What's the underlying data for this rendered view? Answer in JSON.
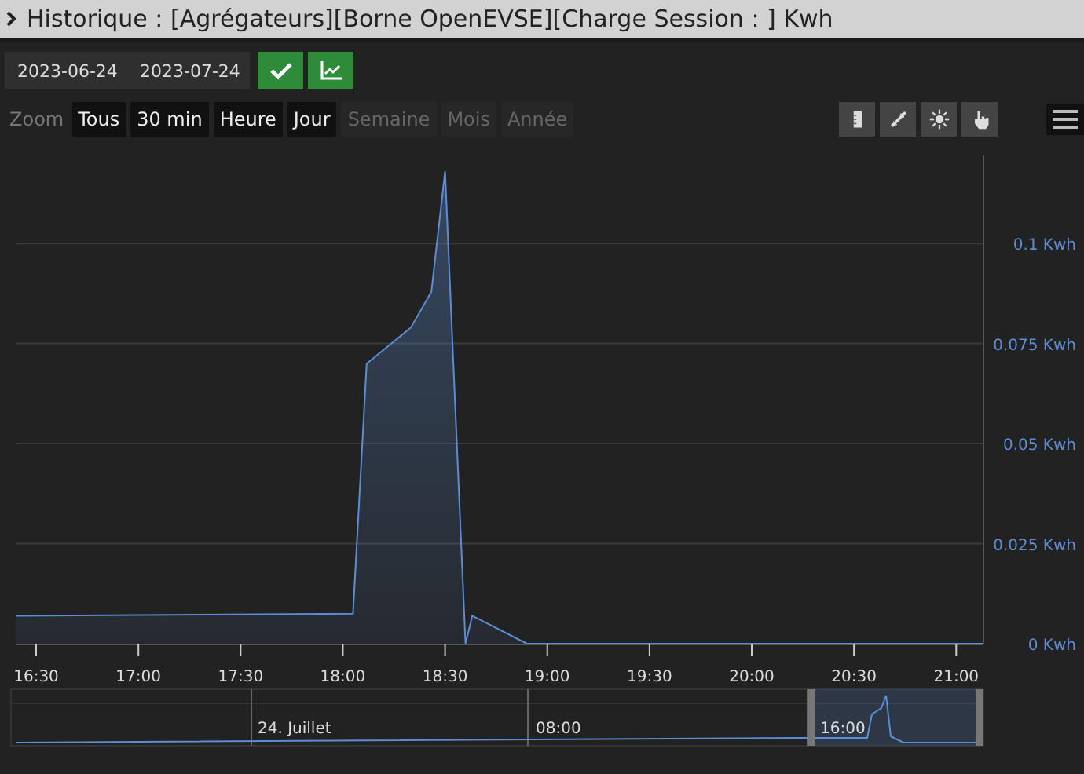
{
  "header": {
    "title": "Historique : [Agrégateurs][Borne OpenEVSE][Charge Session : ] Kwh"
  },
  "date_range": {
    "start": "2023-06-24",
    "end": "2023-07-24"
  },
  "zoom": {
    "label": "Zoom",
    "buttons": [
      {
        "label": "Tous",
        "disabled": false
      },
      {
        "label": "30 min",
        "disabled": false
      },
      {
        "label": "Heure",
        "disabled": false
      },
      {
        "label": "Jour",
        "disabled": false
      },
      {
        "label": "Semaine",
        "disabled": true
      },
      {
        "label": "Mois",
        "disabled": true
      },
      {
        "label": "Année",
        "disabled": true
      }
    ]
  },
  "tools": [
    {
      "kind": "ruler"
    },
    {
      "kind": "compress"
    },
    {
      "kind": "sun"
    },
    {
      "kind": "hand"
    }
  ],
  "chart": {
    "chart_data": {
      "type": "area",
      "x": [
        984,
        1083,
        1087,
        1100,
        1106,
        1110,
        1116,
        1118,
        1134,
        1268
      ],
      "grid": true,
      "series": [
        {
          "color": "#5b8ed6",
          "values": [
            0.007,
            0.0075,
            0.07,
            0.079,
            0.088,
            0.118,
            0,
            0.007,
            0,
            0
          ]
        }
      ],
      "xlim": [
        984,
        1268
      ],
      "ylim": [
        0,
        0.122
      ],
      "xticks": [
        {
          "value": 990,
          "label": "16:30"
        },
        {
          "value": 1020,
          "label": "17:00"
        },
        {
          "value": 1050,
          "label": "17:30"
        },
        {
          "value": 1080,
          "label": "18:00"
        },
        {
          "value": 1110,
          "label": "18:30"
        },
        {
          "value": 1140,
          "label": "19:00"
        },
        {
          "value": 1170,
          "label": "19:30"
        },
        {
          "value": 1200,
          "label": "20:00"
        },
        {
          "value": 1230,
          "label": "20:30"
        },
        {
          "value": 1260,
          "label": "21:00"
        }
      ],
      "yticks": [
        {
          "value": 0,
          "label": "0 Kwh"
        },
        {
          "value": 0.025,
          "label": "0.025 Kwh"
        },
        {
          "value": 0.05,
          "label": "0.05 Kwh"
        },
        {
          "value": 0.075,
          "label": "0.075 Kwh"
        },
        {
          "value": 0.1,
          "label": "0.1 Kwh"
        }
      ]
    }
  },
  "navigator": {
    "labels": [
      "24. Juillet",
      "08:00",
      "16:00"
    ]
  }
}
